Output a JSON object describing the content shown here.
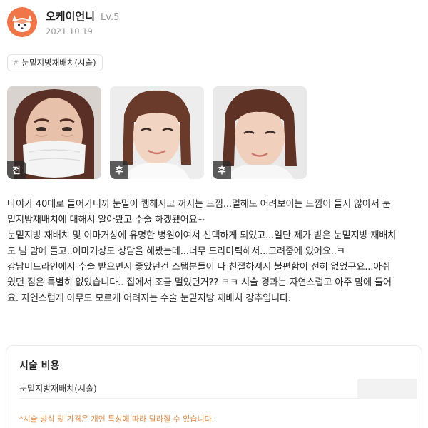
{
  "header": {
    "username": "오케이언니",
    "level": "Lv.5",
    "date": "2021.10.19",
    "avatar_icon": "fox-icon"
  },
  "tag": {
    "hash": "#",
    "label": "눈밑지방재배치(시술)"
  },
  "photos": [
    {
      "badge": "전"
    },
    {
      "badge": "후"
    },
    {
      "badge": "후"
    }
  ],
  "review": {
    "lines": [
      "나이가 40대로 들어가니까 눈밑이 퀭해지고 꺼지는 느낌...멀해도 어려보이는 느낌이 들지 않아서 눈",
      "밑지방재배치에 대해서 알아봤고 수술 하겠됐어요~",
      "눈밑지방 재배치 및 이마거상에 유명한 병원이여서 선택하게 되었고...일단 제가 받은 눈밑지방 재배치",
      "도 넘 맘에 들고..이마거상도 상담을 해봤는데...너무 드라마틱해서...고려중에 있어요..ㅋ",
      "강남미드라인에서 수술 받으면서 좋았던건 스탭분들이 다 친절하셔서 불편함이 전혀 없었구요...아쉬",
      "웠던 점은 특별히 없었습니다.. 집에서 조금 멀었던거?? ㅋㅋ  시술 경과는 자연스럽고 아주 맘에 들어",
      "요. 자연스럽게 아무도 모르게 어려지는 수술 눈밑지방 재배치 강추입니다."
    ]
  },
  "price": {
    "title": "시술 비용",
    "item": "눈밑지방재배치(시술)",
    "note": "*시술 방식 및 가격은 개인 특성에 따라 달라질 수 있습니다."
  },
  "colors": {
    "avatar_bg": "#f0764a",
    "note": "#e38a44"
  }
}
